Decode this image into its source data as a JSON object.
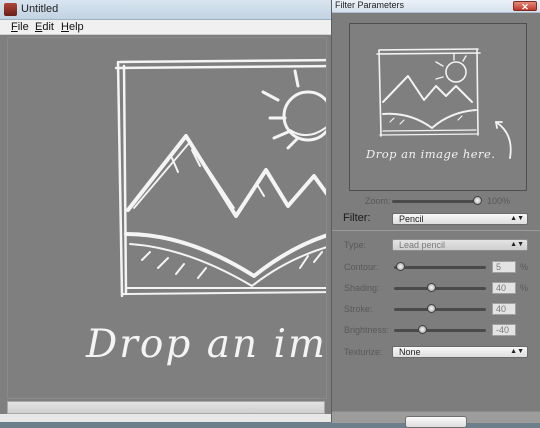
{
  "main_window": {
    "title": "Untitled",
    "menu": [
      {
        "accel": "F",
        "rest": "ile"
      },
      {
        "accel": "E",
        "rest": "dit"
      },
      {
        "accel": "H",
        "rest": "elp"
      }
    ],
    "drop_text": "Drop an image"
  },
  "filter_panel": {
    "title": "Filter Parameters",
    "close_glyph": "✕",
    "preview_text": "Drop an image here.",
    "zoom": {
      "label": "Zoom:",
      "value_text": "100%",
      "level": 1.0
    },
    "filter": {
      "label": "Filter:",
      "selected": "Pencil"
    },
    "type": {
      "label": "Type:",
      "selected": "Lead pencil"
    },
    "sliders": [
      {
        "label": "Contour:",
        "value": "5",
        "unit": "%",
        "level": 0.05
      },
      {
        "label": "Shading:",
        "value": "40",
        "unit": "%",
        "level": 0.4
      },
      {
        "label": "Stroke:",
        "value": "40",
        "unit": "",
        "level": 0.4
      },
      {
        "label": "Brightness:",
        "value": "-40",
        "unit": "",
        "level": 0.3
      }
    ],
    "texturize": {
      "label": "Texturize:",
      "selected": "None"
    }
  },
  "colors": {
    "canvas_gray": "#7f7f7f",
    "sketch_white": "#f4f4f4",
    "disabled_text": "#595959"
  },
  "icons": [
    "app-icon",
    "close-icon",
    "dropdown-arrow-icon",
    "slider-thumb-icon"
  ]
}
